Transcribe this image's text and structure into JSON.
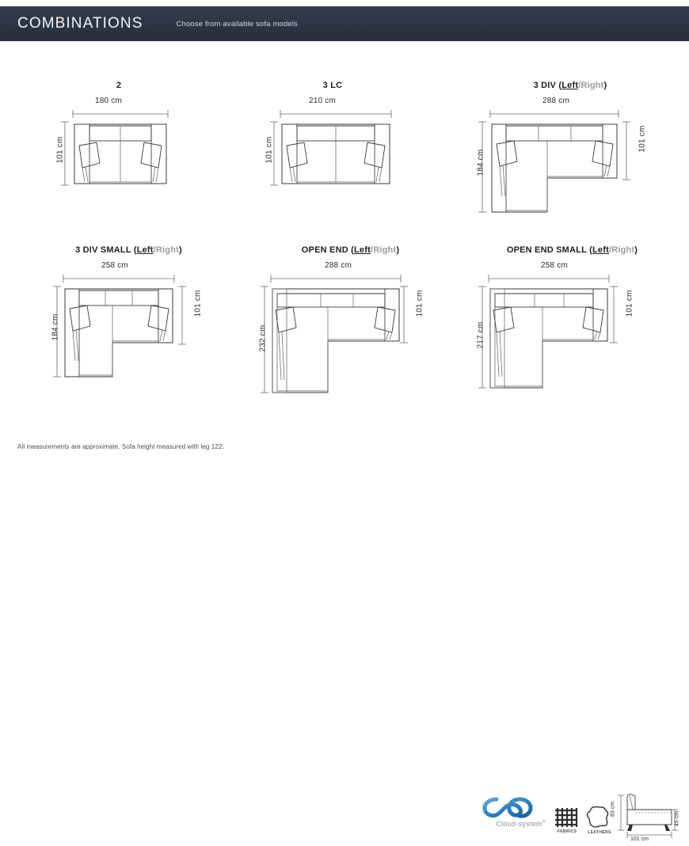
{
  "header": {
    "title": "COMBINATIONS",
    "subtitle": "Choose from available sofa models",
    "bg_color": "#2e3645"
  },
  "models": [
    {
      "id": "model-2",
      "name": "2",
      "name_prefix": "2",
      "has_sides": false,
      "side_left": "",
      "side_right": "",
      "width_label": "180 cm",
      "depth_label": "101 cm",
      "width_cm": 180,
      "depth_cm": 101,
      "shape": "straight",
      "seats": 2
    },
    {
      "id": "model-3lc",
      "name": "3 LC",
      "name_prefix": "3 LC",
      "has_sides": false,
      "side_left": "",
      "side_right": "",
      "width_label": "210 cm",
      "depth_label": "101 cm",
      "width_cm": 210,
      "depth_cm": 101,
      "shape": "straight",
      "seats": 2
    },
    {
      "id": "model-3div",
      "name": "3 DIV (Left/Right)",
      "name_prefix": "3 DIV ",
      "has_sides": true,
      "side_left": "Left",
      "side_right": "/Right",
      "width_label": "288 cm",
      "depth_label": "101 cm",
      "chaise_depth_label": "184 cm",
      "width_cm": 288,
      "depth_cm": 101,
      "chaise_depth_cm": 184,
      "shape": "corner-left",
      "seats": 3
    },
    {
      "id": "model-3div-small",
      "name": "3 DIV SMALL (Left/Right)",
      "name_prefix": "3 DIV SMALL ",
      "has_sides": true,
      "side_left": "Left",
      "side_right": "/Right",
      "width_label": "258 cm",
      "depth_label": "101 cm",
      "chaise_depth_label": "184 cm",
      "width_cm": 258,
      "depth_cm": 101,
      "chaise_depth_cm": 184,
      "shape": "corner-left",
      "seats": 3
    },
    {
      "id": "model-open-end",
      "name": "OPEN END (Left/Right)",
      "name_prefix": "OPEN END ",
      "has_sides": true,
      "side_left": "Left",
      "side_right": "/Right",
      "width_label": "288 cm",
      "depth_label": "101 cm",
      "chaise_depth_label": "232 cm",
      "width_cm": 288,
      "depth_cm": 101,
      "chaise_depth_cm": 232,
      "shape": "open-end-left",
      "seats": 3
    },
    {
      "id": "model-open-end-small",
      "name": "OPEN END SMALL (Left/Right)",
      "name_prefix": "OPEN END SMALL ",
      "has_sides": true,
      "side_left": "Left",
      "side_right": "/Right",
      "width_label": "258 cm",
      "depth_label": "101 cm",
      "chaise_depth_label": "217 cm",
      "width_cm": 258,
      "depth_cm": 101,
      "chaise_depth_cm": 217,
      "shape": "open-end-left",
      "seats": 3
    }
  ],
  "footer": {
    "note": "All measurements are approximate. Sofa height measured with leg 122.",
    "cloud_system_label": "Cloud-system",
    "cloud_trademark": "®",
    "fabrics_label": "FABRICS",
    "leathers_label": "LEATHERS",
    "side_view": {
      "height_label": "83 cm",
      "seat_height_label": "45 cm",
      "depth_label": "101 cm"
    },
    "logo_color": "#2a7fc1"
  }
}
